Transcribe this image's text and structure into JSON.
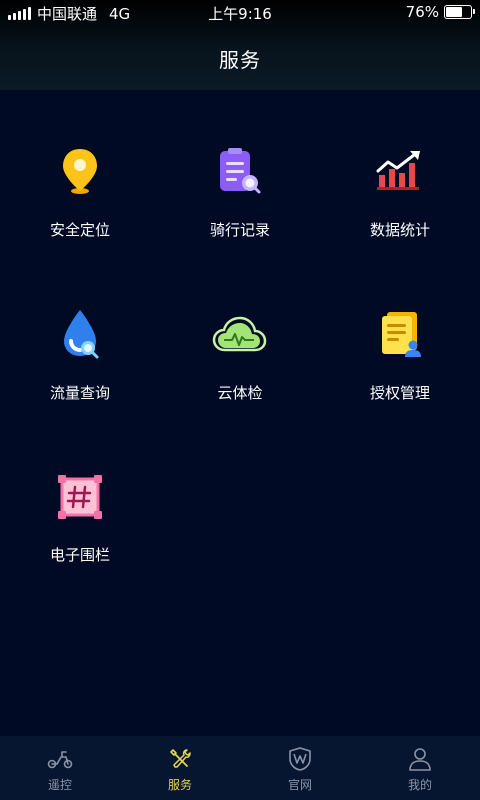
{
  "status_bar": {
    "carrier": "中国联通",
    "network": "4G",
    "time": "上午9:16",
    "battery": "76%",
    "battery_level": 0.76
  },
  "header": {
    "title": "服务"
  },
  "services": [
    {
      "label": "安全定位",
      "icon": "location-pin-icon"
    },
    {
      "label": "骑行记录",
      "icon": "ride-record-icon"
    },
    {
      "label": "数据统计",
      "icon": "statistics-chart-icon"
    },
    {
      "label": "流量查询",
      "icon": "data-drop-search-icon"
    },
    {
      "label": "云体检",
      "icon": "cloud-check-icon"
    },
    {
      "label": "授权管理",
      "icon": "authorization-icon"
    },
    {
      "label": "电子围栏",
      "icon": "geofence-icon"
    }
  ],
  "tabbar": {
    "active": "服务",
    "active_color": "#e4d451",
    "items": [
      {
        "label": "遥控",
        "icon": "scooter-icon"
      },
      {
        "label": "服务",
        "icon": "tools-icon"
      },
      {
        "label": "官网",
        "icon": "shield-icon"
      },
      {
        "label": "我的",
        "icon": "user-icon"
      }
    ]
  }
}
